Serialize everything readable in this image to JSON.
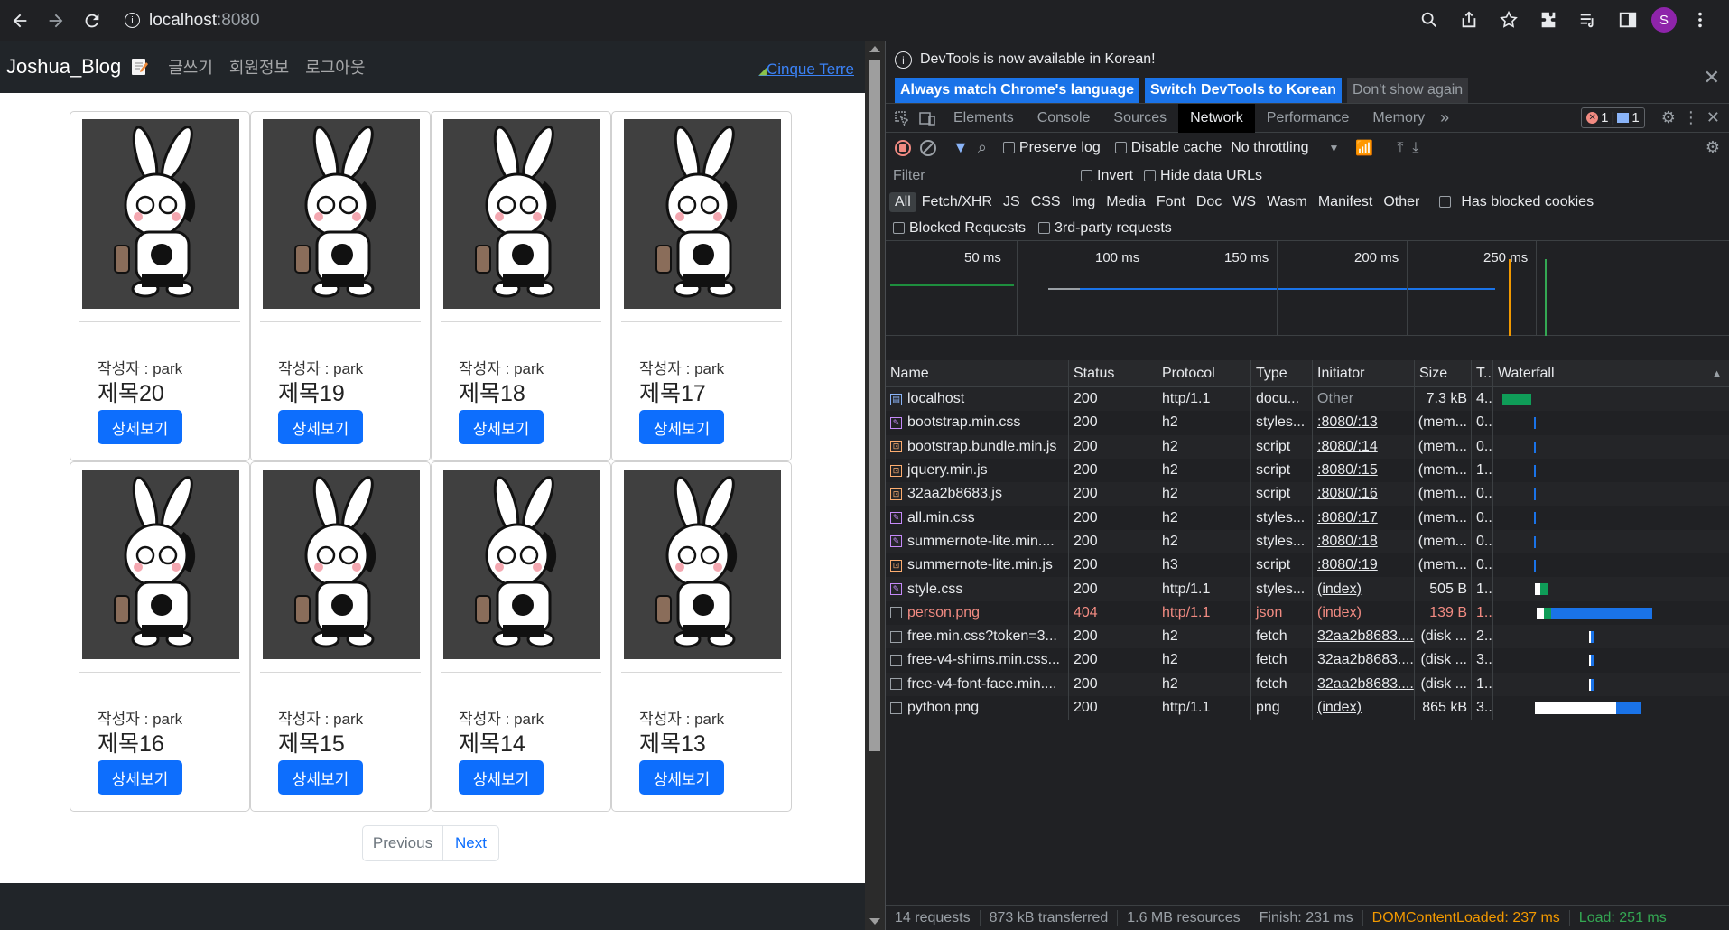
{
  "browser": {
    "url_host": "localhost",
    "url_port": ":8080",
    "profile_initial": "S"
  },
  "site": {
    "brand": "Joshua_Blog",
    "menu": [
      "글쓰기",
      "회원정보",
      "로그아웃"
    ],
    "right_link": "Cinque Terre",
    "cards": [
      {
        "author": "작성자 : park",
        "title": "제목20",
        "button": "상세보기"
      },
      {
        "author": "작성자 : park",
        "title": "제목19",
        "button": "상세보기"
      },
      {
        "author": "작성자 : park",
        "title": "제목18",
        "button": "상세보기"
      },
      {
        "author": "작성자 : park",
        "title": "제목17",
        "button": "상세보기"
      },
      {
        "author": "작성자 : park",
        "title": "제목16",
        "button": "상세보기"
      },
      {
        "author": "작성자 : park",
        "title": "제목15",
        "button": "상세보기"
      },
      {
        "author": "작성자 : park",
        "title": "제목14",
        "button": "상세보기"
      },
      {
        "author": "작성자 : park",
        "title": "제목13",
        "button": "상세보기"
      }
    ],
    "pager": {
      "previous": "Previous",
      "next": "Next"
    }
  },
  "devtools": {
    "info_text": "DevTools is now available in Korean!",
    "info_buttons": [
      "Always match Chrome's language",
      "Switch DevTools to Korean",
      "Don't show again"
    ],
    "tabs": [
      "Elements",
      "Console",
      "Sources",
      "Network",
      "Performance",
      "Memory"
    ],
    "active_tab": "Network",
    "error_count": "1",
    "message_count": "1",
    "preserve_log": "Preserve log",
    "disable_cache": "Disable cache",
    "throttling": "No throttling",
    "filter_placeholder": "Filter",
    "invert": "Invert",
    "hide_data_urls": "Hide data URLs",
    "type_filters": [
      "All",
      "Fetch/XHR",
      "JS",
      "CSS",
      "Img",
      "Media",
      "Font",
      "Doc",
      "WS",
      "Wasm",
      "Manifest",
      "Other"
    ],
    "has_blocked_cookies": "Has blocked cookies",
    "blocked_requests": "Blocked Requests",
    "third_party": "3rd-party requests",
    "overview_ticks": [
      "50 ms",
      "100 ms",
      "150 ms",
      "200 ms",
      "250 ms"
    ],
    "columns": [
      "Name",
      "Status",
      "Protocol",
      "Type",
      "Initiator",
      "Size",
      "T...",
      "Waterfall"
    ],
    "requests": [
      {
        "name": "localhost",
        "status": "200",
        "protocol": "http/1.1",
        "type": "docu...",
        "initiator": "Other",
        "size": "7.3 kB",
        "time": "4...",
        "icon": "doc"
      },
      {
        "name": "bootstrap.min.css",
        "status": "200",
        "protocol": "h2",
        "type": "styles...",
        "initiator": ":8080/:13",
        "size": "(mem...",
        "time": "0...",
        "icon": "css"
      },
      {
        "name": "bootstrap.bundle.min.js",
        "status": "200",
        "protocol": "h2",
        "type": "script",
        "initiator": ":8080/:14",
        "size": "(mem...",
        "time": "0...",
        "icon": "js"
      },
      {
        "name": "jquery.min.js",
        "status": "200",
        "protocol": "h2",
        "type": "script",
        "initiator": ":8080/:15",
        "size": "(mem...",
        "time": "1...",
        "icon": "js"
      },
      {
        "name": "32aa2b8683.js",
        "status": "200",
        "protocol": "h2",
        "type": "script",
        "initiator": ":8080/:16",
        "size": "(mem...",
        "time": "0...",
        "icon": "js"
      },
      {
        "name": "all.min.css",
        "status": "200",
        "protocol": "h2",
        "type": "styles...",
        "initiator": ":8080/:17",
        "size": "(mem...",
        "time": "0...",
        "icon": "css"
      },
      {
        "name": "summernote-lite.min....",
        "status": "200",
        "protocol": "h2",
        "type": "styles...",
        "initiator": ":8080/:18",
        "size": "(mem...",
        "time": "0...",
        "icon": "css"
      },
      {
        "name": "summernote-lite.min.js",
        "status": "200",
        "protocol": "h3",
        "type": "script",
        "initiator": ":8080/:19",
        "size": "(mem...",
        "time": "0...",
        "icon": "js"
      },
      {
        "name": "style.css",
        "status": "200",
        "protocol": "http/1.1",
        "type": "styles...",
        "initiator": "(index)",
        "size": "505 B",
        "time": "1...",
        "icon": "css"
      },
      {
        "name": "person.png",
        "status": "404",
        "protocol": "http/1.1",
        "type": "json",
        "initiator": "(index)",
        "size": "139 B",
        "time": "1...",
        "icon": "img"
      },
      {
        "name": "free.min.css?token=3...",
        "status": "200",
        "protocol": "h2",
        "type": "fetch",
        "initiator": "32aa2b8683....",
        "size": "(disk ...",
        "time": "2...",
        "icon": "other"
      },
      {
        "name": "free-v4-shims.min.css...",
        "status": "200",
        "protocol": "h2",
        "type": "fetch",
        "initiator": "32aa2b8683....",
        "size": "(disk ...",
        "time": "3...",
        "icon": "other"
      },
      {
        "name": "free-v4-font-face.min....",
        "status": "200",
        "protocol": "h2",
        "type": "fetch",
        "initiator": "32aa2b8683....",
        "size": "(disk ...",
        "time": "1...",
        "icon": "other"
      },
      {
        "name": "python.png",
        "status": "200",
        "protocol": "http/1.1",
        "type": "png",
        "initiator": "(index)",
        "size": "865 kB",
        "time": "3...",
        "icon": "img"
      }
    ],
    "status": {
      "requests": "14 requests",
      "transferred": "873 kB transferred",
      "resources": "1.6 MB resources",
      "finish": "Finish: 231 ms",
      "dom_loaded": "DOMContentLoaded: 237 ms",
      "load": "Load: 251 ms"
    },
    "colors": {
      "dom_loaded": "#f29900",
      "load": "#34a853",
      "error": "#f28b82",
      "accent": "#1a73e8"
    }
  }
}
